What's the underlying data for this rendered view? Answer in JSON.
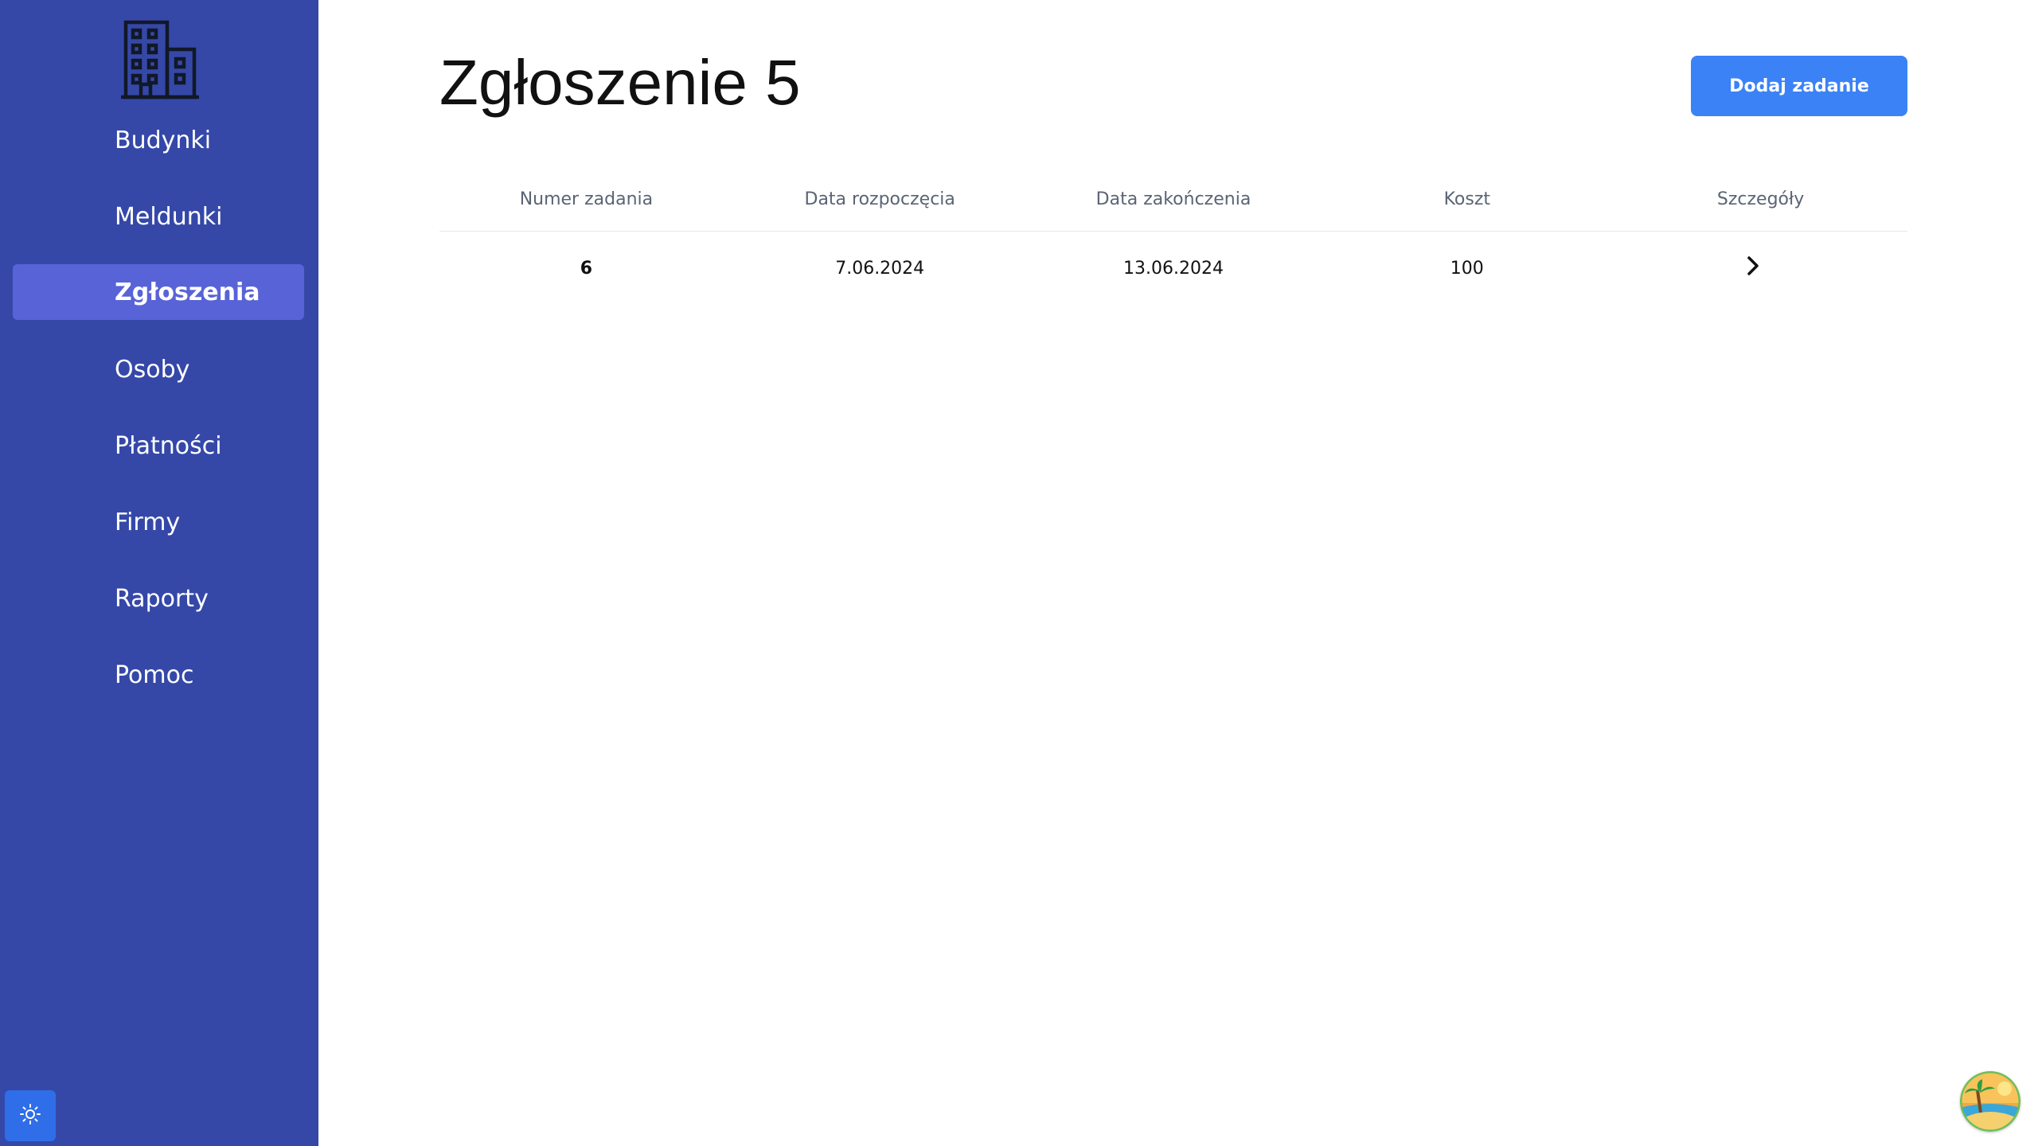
{
  "sidebar": {
    "logo_icon": "building-icon",
    "items": [
      {
        "label": "Budynki",
        "active": false
      },
      {
        "label": "Meldunki",
        "active": false
      },
      {
        "label": "Zgłoszenia",
        "active": true
      },
      {
        "label": "Osoby",
        "active": false
      },
      {
        "label": "Płatności",
        "active": false
      },
      {
        "label": "Firmy",
        "active": false
      },
      {
        "label": "Raporty",
        "active": false
      },
      {
        "label": "Pomoc",
        "active": false
      }
    ],
    "theme_toggle_icon": "sun-icon"
  },
  "main": {
    "title": "Zgłoszenie 5",
    "add_button_label": "Dodaj zadanie",
    "table": {
      "headers": [
        "Numer zadania",
        "Data rozpoczęcia",
        "Data zakończenia",
        "Koszt",
        "Szczegóły"
      ],
      "rows": [
        {
          "number": "6",
          "start": "7.06.2024",
          "end": "13.06.2024",
          "cost": "100",
          "details_icon": "chevron-right-icon"
        }
      ]
    }
  },
  "avatar_icon": "beach-avatar-icon",
  "colors": {
    "sidebar_bg": "#3548a8",
    "active_item_bg": "#5863d8",
    "accent": "#3b82f6",
    "toggle_bg": "#2f6ee8"
  }
}
